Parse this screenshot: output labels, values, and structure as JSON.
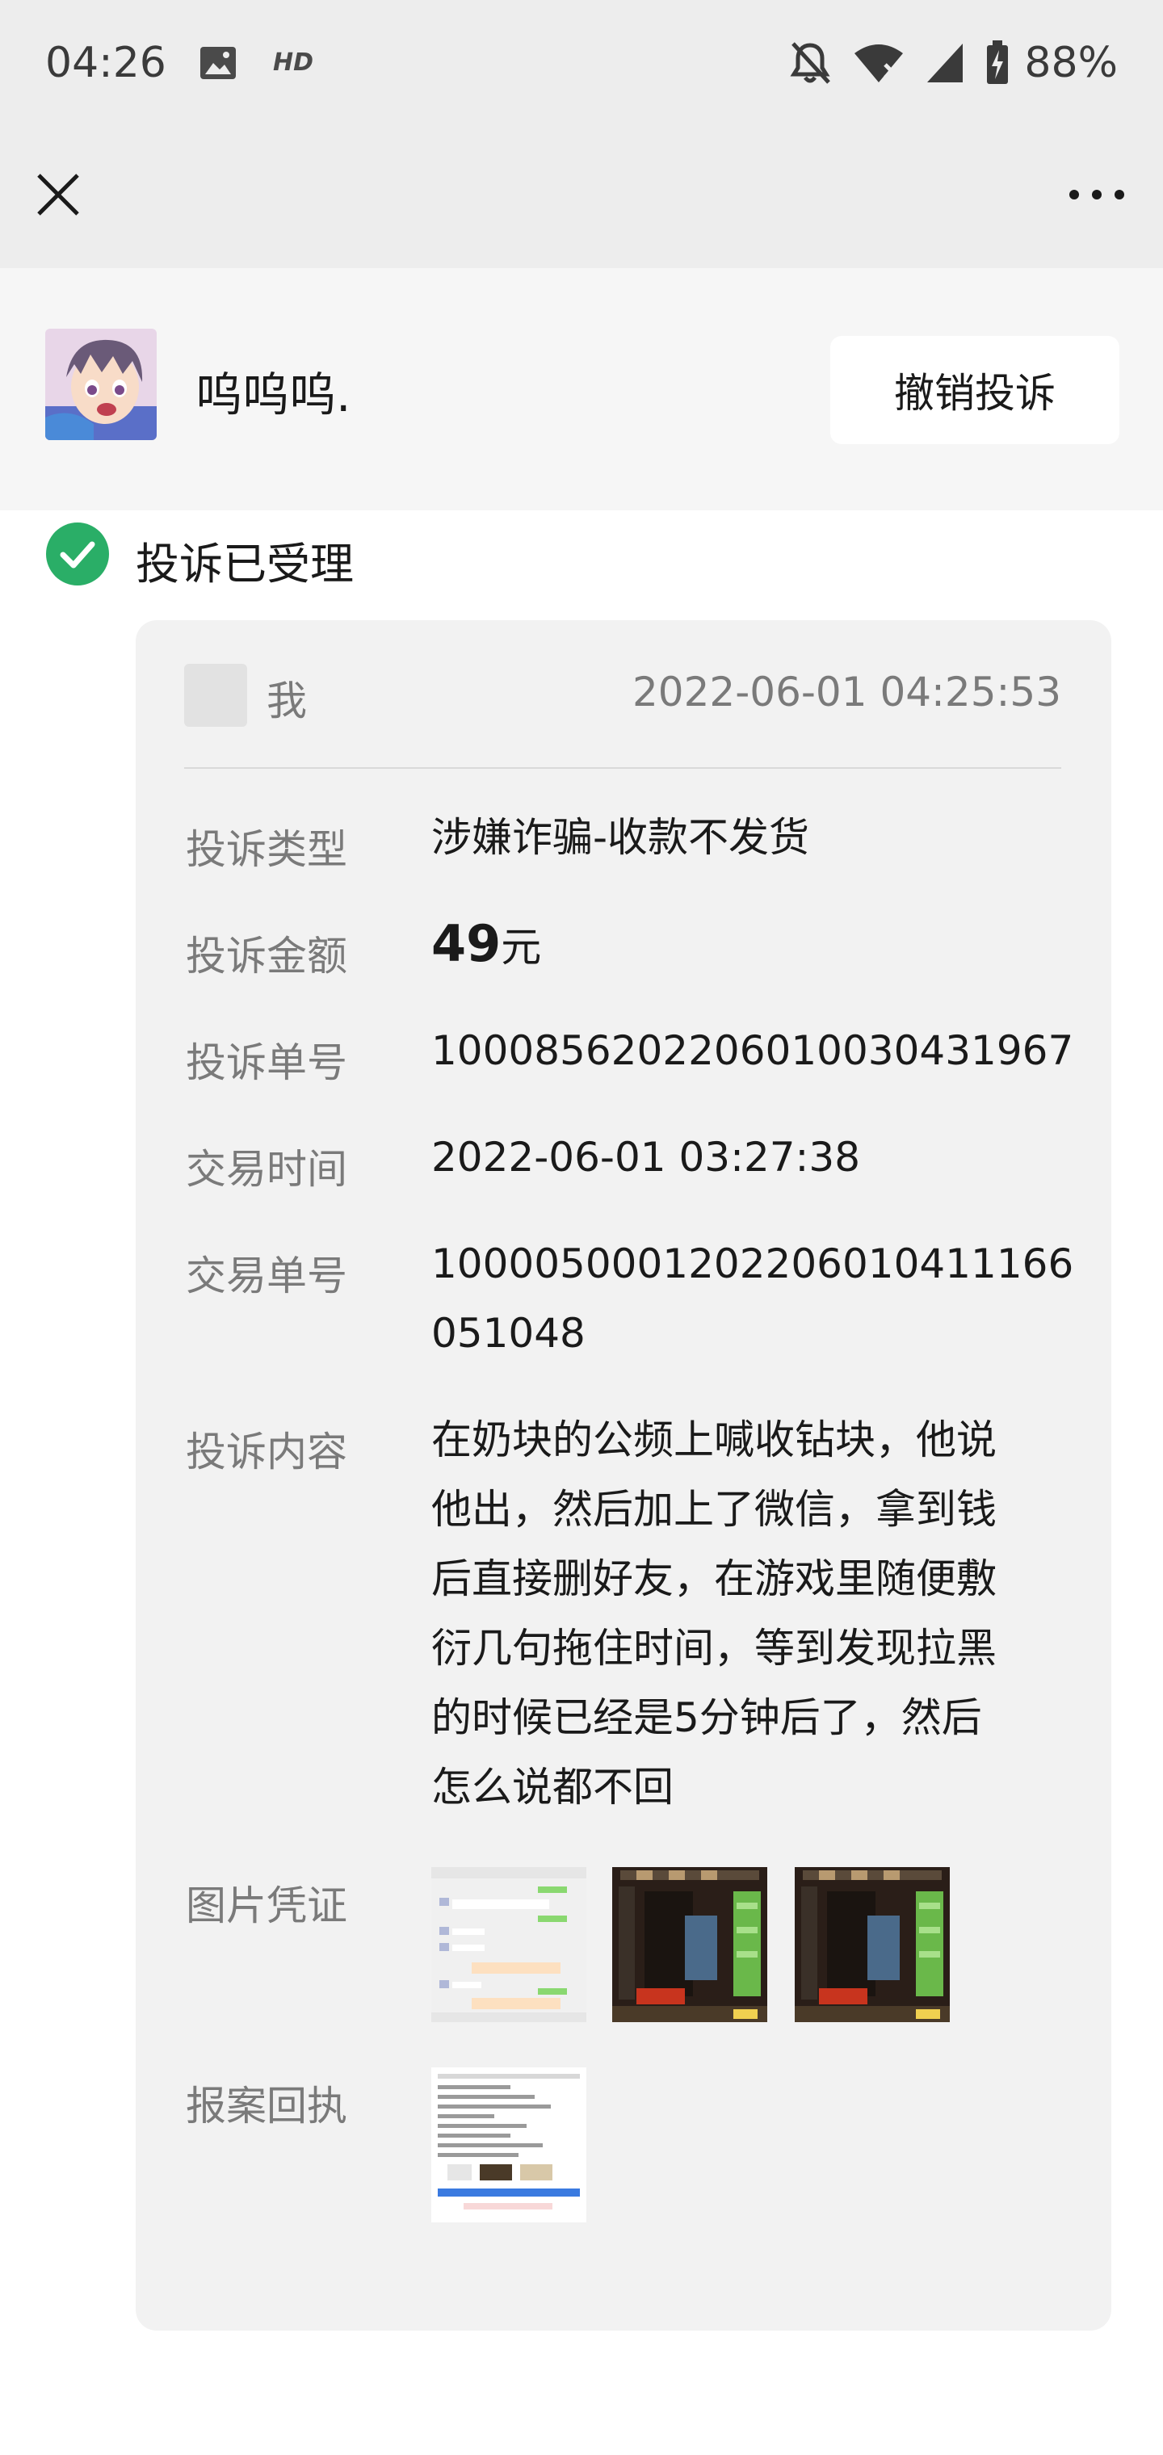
{
  "status_bar": {
    "time": "04:26",
    "hd_label": "HD",
    "battery": "88%",
    "icons": [
      "image-icon",
      "hd-icon",
      "bell-off-icon",
      "wifi-x-icon",
      "signal-icon",
      "battery-charging-icon"
    ]
  },
  "nav": {
    "close_icon": "close-icon",
    "more_icon": "more-icon"
  },
  "header": {
    "username": "呜呜呜.",
    "revoke_label": "撤销投诉"
  },
  "status": {
    "label": "投诉已受理",
    "icon": "check-circle-icon",
    "color": "#2aae67"
  },
  "card": {
    "author": "我",
    "timestamp": "2022-06-01 04:25:53",
    "rows": {
      "type_label": "投诉类型",
      "type_value": "涉嫌诈骗-收款不发货",
      "amount_label": "投诉金额",
      "amount_value": "49",
      "amount_unit": "元",
      "complaint_no_label": "投诉单号",
      "complaint_no_value": "100085620220601003043196 7",
      "trade_time_label": "交易时间",
      "trade_time_value": "2022-06-01 03:27:38",
      "trade_no_label": "交易单号",
      "trade_no_line1": "1000050001202206010411166",
      "trade_no_line2": "051048",
      "content_label": "投诉内容",
      "content_lines": [
        "在奶块的公频上喊收钻块，他说",
        "他出，然后加上了微信，拿到钱",
        "后直接删好友，在游戏里随便敷",
        "衍几句拖住时间，等到发现拉黑",
        "的时候已经是5分钟后了，然后",
        "怎么说都不回"
      ],
      "evidence_label": "图片凭证",
      "report_label": "报案回执"
    }
  }
}
